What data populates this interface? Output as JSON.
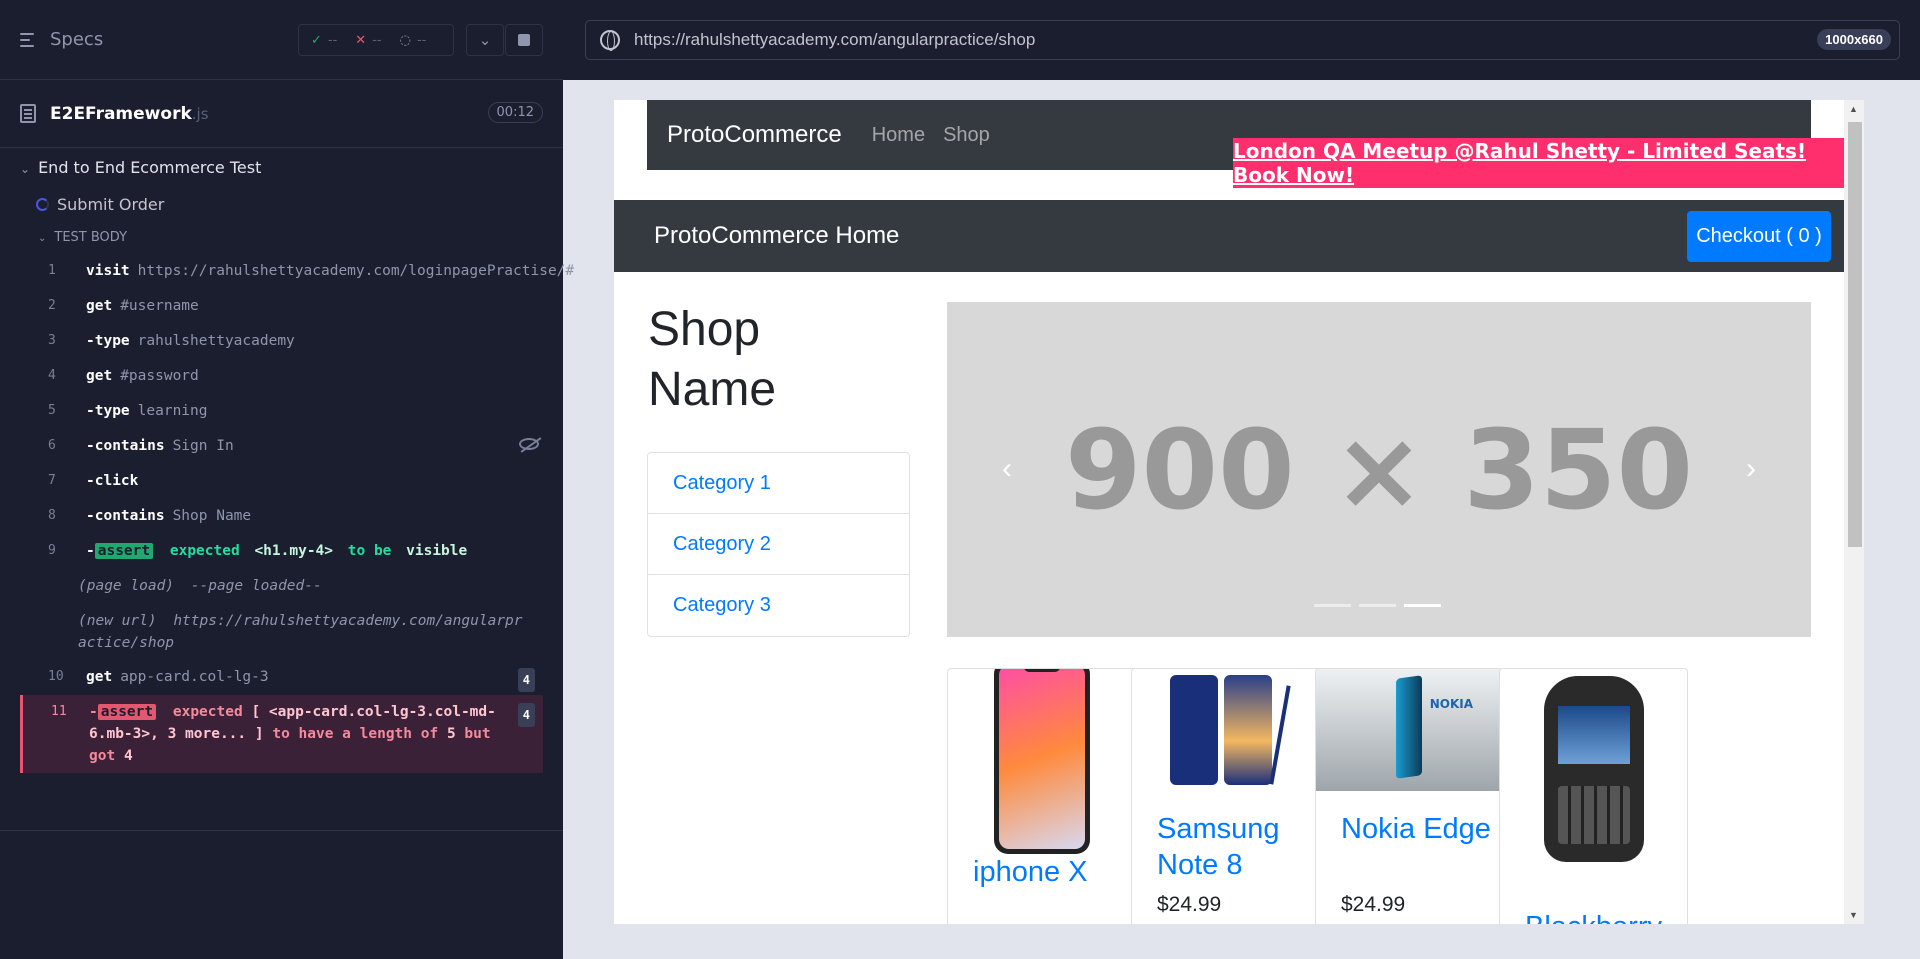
{
  "reporter": {
    "header_label": "Specs",
    "stats": {
      "passed": "--",
      "failed": "--",
      "pending": "--"
    },
    "file": {
      "name": "E2EFramework",
      "ext": ".js",
      "duration": "00:12"
    },
    "suite_title": "End to End Ecommerce Test",
    "test_title": "Submit Order",
    "test_body_label": "TEST BODY",
    "commands": [
      {
        "num": "1",
        "name": "visit",
        "arg": "https://rahulshettyacademy.com/loginpagePractise/#"
      },
      {
        "num": "2",
        "name": "get",
        "arg": "#username"
      },
      {
        "num": "3",
        "name": "-type",
        "arg": "rahulshettyacademy"
      },
      {
        "num": "4",
        "name": "get",
        "arg": "#password"
      },
      {
        "num": "5",
        "name": "-type",
        "arg": "learning"
      },
      {
        "num": "6",
        "name": "-contains",
        "arg": "Sign In"
      },
      {
        "num": "7",
        "name": "-click",
        "arg": ""
      },
      {
        "num": "8",
        "name": "-contains",
        "arg": "Shop Name"
      }
    ],
    "assert9": {
      "num": "9",
      "prefix": "-",
      "tag": "assert",
      "w1": "expected",
      "w2": "<h1.my-4>",
      "w3": "to be",
      "w4": "visible"
    },
    "page_load": {
      "label": "(page load)",
      "text": "--page loaded--"
    },
    "new_url": {
      "label": "(new url)",
      "text": "https://rahulshettyacademy.com/angularpractice/shop"
    },
    "cmd10": {
      "num": "10",
      "name": "get",
      "arg": "app-card.col-lg-3",
      "badge": "4"
    },
    "assert11": {
      "num": "11",
      "prefix": "-",
      "tag": "assert",
      "w1": "expected",
      "w2": "[ <app-card.col-lg-3.col-md-6.mb-3>, 3 more... ]",
      "w3": "to have a length of",
      "w4": "5",
      "w5": "but got",
      "w6": "4",
      "badge": "4"
    }
  },
  "browser": {
    "url": "https://rahulshettyacademy.com/angularpractice/shop",
    "viewport": "1000x660"
  },
  "app": {
    "brand": "ProtoCommerce",
    "nav": [
      "Home",
      "Shop"
    ],
    "promo": "London QA Meetup @Rahul Shetty - Limited Seats! Book Now!",
    "home_title": "ProtoCommerce Home",
    "checkout": "Checkout ( 0 )",
    "shop_name": "Shop Name",
    "categories": [
      "Category 1",
      "Category 2",
      "Category 3"
    ],
    "carousel_placeholder": "900 × 350",
    "products": [
      {
        "title": "iphone X",
        "price": ""
      },
      {
        "title": "Samsung Note 8",
        "price": "$24.99"
      },
      {
        "title": "Nokia Edge",
        "price": "$24.99"
      },
      {
        "title": "Blackberry",
        "price": ""
      }
    ],
    "nokia_logo": "NOKIA"
  },
  "colors": {
    "accent": "#007bff",
    "promo": "#ff2f6d",
    "pass": "#1fa971",
    "fail": "#e45770",
    "panel": "#1b1e2e"
  }
}
